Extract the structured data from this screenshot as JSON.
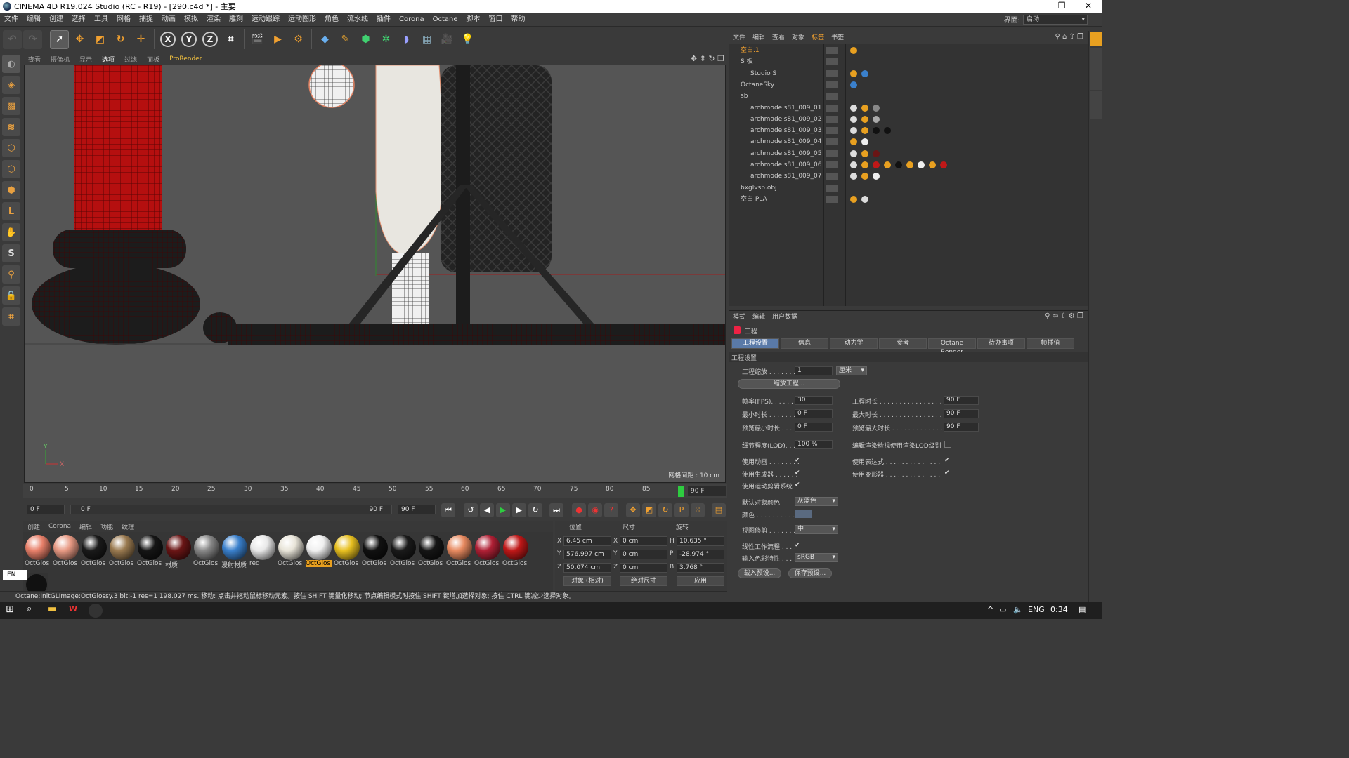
{
  "window": {
    "title": "CINEMA 4D R19.024 Studio (RC - R19) - [290.c4d *] - 主要",
    "controls": [
      "—",
      "❐",
      "✕"
    ]
  },
  "menubar": {
    "items": [
      "文件",
      "编辑",
      "创建",
      "选择",
      "工具",
      "网格",
      "捕捉",
      "动画",
      "模拟",
      "渲染",
      "雕刻",
      "运动跟踪",
      "运动图形",
      "角色",
      "流水线",
      "插件",
      "Corona",
      "Octane",
      "脚本",
      "窗口",
      "帮助"
    ],
    "layout_label": "界面:",
    "layout_value": "启动"
  },
  "viewport": {
    "menu": [
      "查看",
      "摄像机",
      "显示",
      "选项",
      "过滤",
      "面板",
      "ProRender"
    ],
    "grid_info": "网格间距 : 10 cm",
    "axis_y": "Y",
    "axis_x": "X"
  },
  "timeline": {
    "ticks": [
      "0",
      "5",
      "10",
      "15",
      "20",
      "25",
      "30",
      "35",
      "40",
      "45",
      "50",
      "55",
      "60",
      "65",
      "70",
      "75",
      "80",
      "85"
    ],
    "end_label": "90 F",
    "start_field": "0 F",
    "range_start": "0 F",
    "range_end": "90 F",
    "end_field": "90 F"
  },
  "materials": {
    "menu": [
      "创建",
      "Corona",
      "编辑",
      "功能",
      "纹理"
    ],
    "items": [
      {
        "label": "OctGlos",
        "color": "#e8806a"
      },
      {
        "label": "OctGlos",
        "color": "#e89a84"
      },
      {
        "label": "OctGlos",
        "color": "#1a1a1a"
      },
      {
        "label": "OctGlos",
        "color": "#9a7a50"
      },
      {
        "label": "OctGlos",
        "color": "#151515"
      },
      {
        "label": "材质",
        "color": "#6a1515"
      },
      {
        "label": "OctGlos",
        "color": "#888888"
      },
      {
        "label": "漫射材质",
        "color": "#3a80cc"
      },
      {
        "label": "red",
        "color": "#e8e8e8"
      },
      {
        "label": "OctGlos",
        "color": "#e8e4d8"
      },
      {
        "label": "OctGlos",
        "color": "#f0f0f0"
      },
      {
        "label": "OctGlos",
        "color": "#e8c020"
      },
      {
        "label": "OctGlos",
        "color": "#111111"
      },
      {
        "label": "OctGlos",
        "color": "#1a1a1a"
      },
      {
        "label": "OctGlos",
        "color": "#151515"
      },
      {
        "label": "OctGlos",
        "color": "#e88a60"
      },
      {
        "label": "OctGlos",
        "color": "#b02035"
      },
      {
        "label": "OctGlos",
        "color": "#c01818"
      }
    ],
    "active_index": 10
  },
  "coordinates": {
    "headers": [
      "位置",
      "尺寸",
      "旋转"
    ],
    "pos": {
      "x": "6.45 cm",
      "y": "576.997 cm",
      "z": "50.074 cm"
    },
    "size": {
      "x": "0 cm",
      "y": "0 cm",
      "z": "0 cm"
    },
    "rot": {
      "h": "10.635 °",
      "p": "-28.974 °",
      "b": "3.768 °"
    },
    "mode_object": "对象 (相对)",
    "mode_size": "绝对尺寸",
    "apply": "应用"
  },
  "status": "Octane:InitGLImage:OctGlossy.3  bit:-1 res=1  198.027 ms.      移动: 点击并拖动鼠标移动元素。按住 SHIFT 键量化移动; 节点编辑模式时按住 SHIFT 键增加选择对象; 按住 CTRL 键减少选择对象。",
  "object_manager": {
    "menu": [
      "文件",
      "编辑",
      "查看",
      "对象",
      "标签",
      "书签"
    ],
    "rows": [
      {
        "name": "空白.1",
        "depth": 0,
        "color": "#f0a030"
      },
      {
        "name": "S 板",
        "depth": 0,
        "color": "#ccc"
      },
      {
        "name": "Studio S",
        "depth": 1,
        "color": "#ccc"
      },
      {
        "name": "OctaneSky",
        "depth": 0,
        "color": "#ccc"
      },
      {
        "name": "sb",
        "depth": 0,
        "color": "#ccc"
      },
      {
        "name": "archmodels81_009_01",
        "depth": 1,
        "color": "#ccc"
      },
      {
        "name": "archmodels81_009_02",
        "depth": 1,
        "color": "#ccc"
      },
      {
        "name": "archmodels81_009_03",
        "depth": 1,
        "color": "#ccc"
      },
      {
        "name": "archmodels81_009_04",
        "depth": 1,
        "color": "#ccc"
      },
      {
        "name": "archmodels81_009_05",
        "depth": 1,
        "color": "#ccc"
      },
      {
        "name": "archmodels81_009_06",
        "depth": 1,
        "color": "#ccc"
      },
      {
        "name": "archmodels81_009_07",
        "depth": 1,
        "color": "#ccc"
      },
      {
        "name": "bxglvsp.obj",
        "depth": 0,
        "color": "#ccc"
      },
      {
        "name": "空白 PLA",
        "depth": 0,
        "color": "#ccc"
      }
    ]
  },
  "attributes": {
    "menu": [
      "模式",
      "编辑",
      "用户数据"
    ],
    "title": "工程",
    "tabs": [
      "工程设置",
      "信息",
      "动力学",
      "参考",
      "Octane Render",
      "待办事项",
      "帧插值"
    ],
    "section": "工程设置",
    "scale_label": "工程缩放 . . . . . . . .",
    "scale_value": "1",
    "scale_unit": "厘米",
    "scale_btn": "缩放工程...",
    "fps_label": "帧率(FPS). . . . . . .",
    "fps_value": "30",
    "min_label": "最小时长 . . . . . . . .",
    "min_value": "0 F",
    "pmin_label": "预览最小时长 . . . .",
    "pmin_value": "0 F",
    "len_label": "工程时长 . . . . . . . . . . . . . . . . . . .",
    "len_value": "90 F",
    "max_label": "最大时长 . . . . . . . . . . . . . . . . . . .",
    "max_value": "90 F",
    "pmax_label": "预览最大时长 . . . . . . . . . . . . . . .",
    "pmax_value": "90 F",
    "lod_label": "细节程度(LOD). . . .",
    "lod_value": "100 %",
    "lod_check_label": "编辑渲染检视使用渲染LOD级别",
    "anim_label": "使用动画 . . . . . . . .",
    "gen_label": "使用生成器 . . . . . .",
    "motion_label": "使用运动剪辑系统",
    "expr_label": "使用表达式 . . . . . . . . . . . . . . . . .",
    "deform_label": "使用变形器 . . . . . . . . . . . . . . . . .",
    "defcolor_label": "默认对象颜色",
    "defcolor_value": "灰蓝色",
    "color_label": "颜色 . . . . . . . . . . .",
    "clip_label": "视图修剪 . . . . . . . .",
    "clip_value": "中",
    "linear_label": "线性工作流程 . . . .",
    "profile_label": "输入色彩特性 . . . .",
    "profile_value": "sRGB",
    "load_preset": "载入预设...",
    "save_preset": "保存预设..."
  },
  "taskbar": {
    "lang": "ENG",
    "time": "0:34"
  },
  "ime": "EN"
}
